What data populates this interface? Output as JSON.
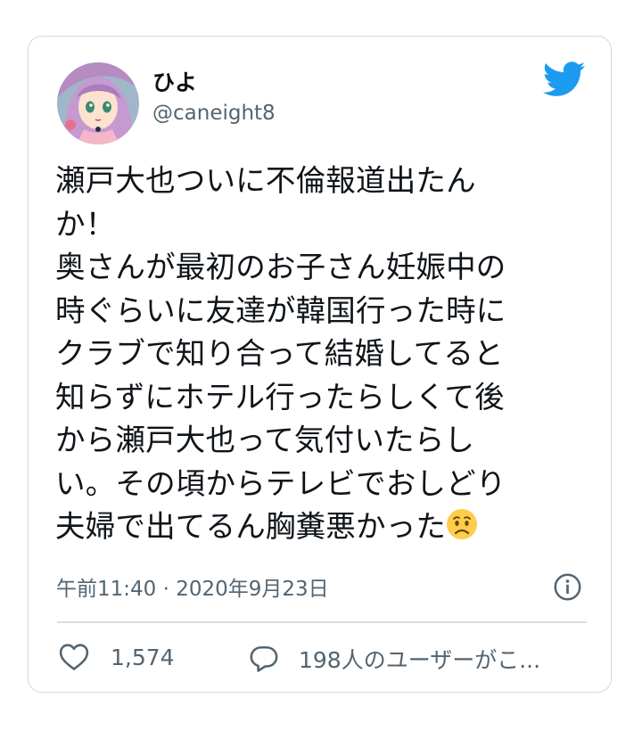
{
  "tweet": {
    "display_name": "ひよ",
    "handle": "@caneight8",
    "text_lines": [
      "瀬戸大也ついに不倫報道出たん",
      "か！",
      "奥さんが最初のお子さん妊娠中の",
      "時ぐらいに友達が韓国行った時に",
      "クラブで知り合って結婚してると",
      "知らずにホテル行ったらしくて後",
      "から瀬戸大也って気付いたらし",
      "い。その頃からテレビでおしどり",
      "夫婦で出てるん胸糞悪かった"
    ],
    "emoji": "worried-face-emoji",
    "timestamp": "午前11:40 · 2020年9月23日",
    "likes": "1,574",
    "replies_label": "198人のユーザーがこ..."
  },
  "icons": {
    "brand": "twitter-bird-icon",
    "info": "info-icon",
    "like": "heart-icon",
    "reply": "speech-bubble-icon"
  },
  "colors": {
    "twitter_blue": "#1d9bf0",
    "secondary_text": "#536471",
    "border": "#cfd9de"
  }
}
